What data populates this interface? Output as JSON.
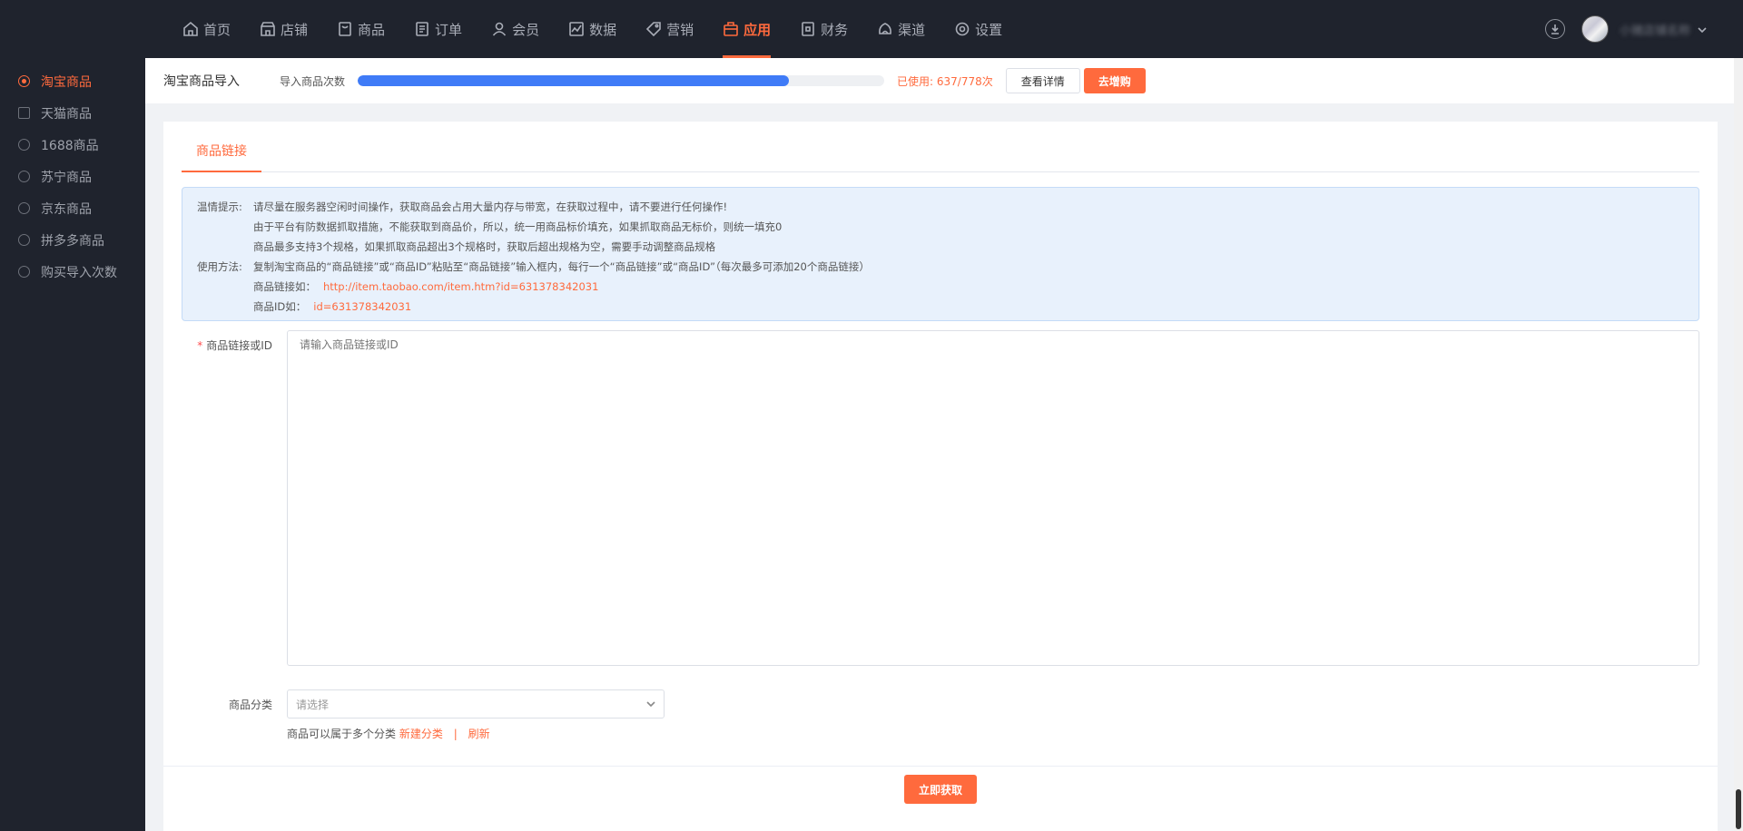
{
  "topnav": {
    "items": [
      {
        "label": "首页",
        "icon": "home-icon"
      },
      {
        "label": "店铺",
        "icon": "store-icon"
      },
      {
        "label": "商品",
        "icon": "goods-icon"
      },
      {
        "label": "订单",
        "icon": "order-icon"
      },
      {
        "label": "会员",
        "icon": "member-icon"
      },
      {
        "label": "数据",
        "icon": "chart-icon"
      },
      {
        "label": "营销",
        "icon": "tag-icon"
      },
      {
        "label": "应用",
        "icon": "app-icon",
        "active": true
      },
      {
        "label": "财务",
        "icon": "finance-icon"
      },
      {
        "label": "渠道",
        "icon": "channel-icon"
      },
      {
        "label": "设置",
        "icon": "gear-icon"
      }
    ]
  },
  "user": {
    "name": "小猪店铺名称"
  },
  "sidebar": {
    "items": [
      {
        "label": "淘宝商品",
        "active": true
      },
      {
        "label": "天猫商品"
      },
      {
        "label": "1688商品"
      },
      {
        "label": "苏宁商品"
      },
      {
        "label": "京东商品"
      },
      {
        "label": "拼多多商品"
      },
      {
        "label": "购买导入次数"
      }
    ]
  },
  "header": {
    "title": "淘宝商品导入",
    "usage_label": "导入商品次数",
    "usage_used": 637,
    "usage_total": 778,
    "usage_text": "已使用: 637/778次",
    "details_button": "查看详情",
    "buy_button": "去增购"
  },
  "tabs": [
    {
      "label": "商品链接",
      "active": true
    }
  ],
  "notice": {
    "tip_label": "温情提示:",
    "tip_lines": [
      "请尽量在服务器空闲时间操作，获取商品会占用大量内存与带宽，在获取过程中，请不要进行任何操作!",
      "由于平台有防数据抓取措施，不能获取到商品价，所以，统一用商品标价填充，如果抓取商品无标价，则统一填充0",
      "商品最多支持3个规格，如果抓取商品超出3个规格时，获取后超出规格为空，需要手动调整商品规格"
    ],
    "usage_label": "使用方法:",
    "usage_line": "复制淘宝商品的“商品链接”或“商品ID”粘贴至“商品链接”输入框内，每行一个“商品链接”或“商品ID”（每次最多可添加20个商品链接）",
    "link_example_label": "商品链接如：",
    "link_example": "http://item.taobao.com/item.htm?id=631378342031",
    "id_example_label": "商品ID如：",
    "id_example": "id=631378342031"
  },
  "form": {
    "link_label": "商品链接或ID",
    "link_placeholder": "请输入商品链接或ID",
    "category_label": "商品分类",
    "category_placeholder": "请选择",
    "category_hint": "商品可以属于多个分类",
    "new_category_link": "新建分类",
    "separator": "|",
    "refresh_link": "刷新"
  },
  "footer": {
    "submit_button": "立即获取"
  },
  "colors": {
    "accent": "#ff6a3d",
    "progress": "#3f7bf7",
    "notice_bg": "#e8f1fc",
    "dark_bg": "#1f232d"
  }
}
